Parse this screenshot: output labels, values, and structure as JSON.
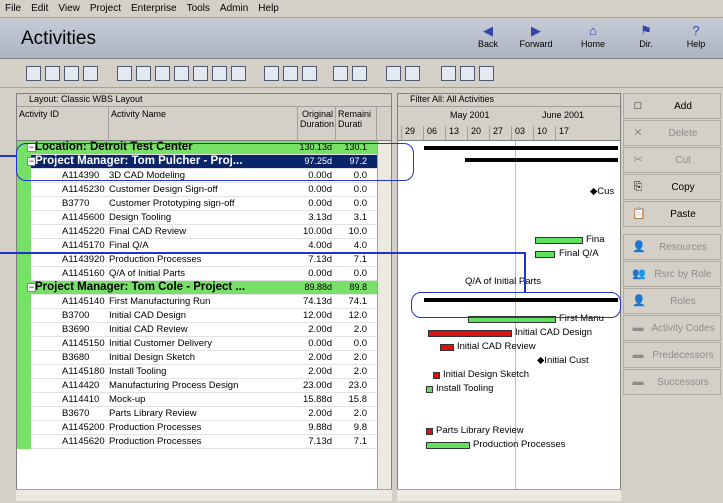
{
  "menu": [
    "File",
    "Edit",
    "View",
    "Project",
    "Enterprise",
    "Tools",
    "Admin",
    "Help"
  ],
  "header": {
    "title": "Activities",
    "nav": [
      {
        "label": "Back",
        "icon": "◀"
      },
      {
        "label": "Forward",
        "icon": "▶"
      },
      {
        "label": "Home",
        "icon": "⌂"
      },
      {
        "label": "Dir.",
        "icon": "⚑"
      },
      {
        "label": "Help",
        "icon": "?"
      }
    ]
  },
  "grid": {
    "layout_label": "Layout: Classic WBS Layout",
    "cols": {
      "id": "Activity ID",
      "name": "Activity Name",
      "orig": "Original Duration",
      "rem": "Remaini Durati"
    }
  },
  "rows": [
    {
      "type": "grp",
      "name": "Location: Detroit Test Center",
      "d1": "130.13d",
      "d2": "130.1"
    },
    {
      "type": "grp",
      "sel": true,
      "name": "Project Manager: Tom Pulcher - Proj...",
      "d1": "97.25d",
      "d2": "97.2"
    },
    {
      "id": "A114390",
      "name": "3D CAD Modeling",
      "d1": "0.00d",
      "d2": "0.0"
    },
    {
      "id": "A1145230",
      "name": "Customer Design Sign-off",
      "d1": "0.00d",
      "d2": "0.0"
    },
    {
      "id": "B3770",
      "name": "Customer Prototyping sign-off",
      "d1": "0.00d",
      "d2": "0.0"
    },
    {
      "id": "A1145600",
      "name": "Design Tooling",
      "d1": "3.13d",
      "d2": "3.1"
    },
    {
      "id": "A1145220",
      "name": "Final CAD Review",
      "d1": "10.00d",
      "d2": "10.0"
    },
    {
      "id": "A1145170",
      "name": "Final Q/A",
      "d1": "4.00d",
      "d2": "4.0"
    },
    {
      "id": "A1143920",
      "name": "Production Processes",
      "d1": "7.13d",
      "d2": "7.1"
    },
    {
      "id": "A1145160",
      "name": "Q/A of Initial Parts",
      "d1": "0.00d",
      "d2": "0.0"
    },
    {
      "type": "grp",
      "name": "Project Manager: Tom Cole - Project ...",
      "d1": "89.88d",
      "d2": "89.8"
    },
    {
      "id": "A1145140",
      "name": "First Manufacturing Run",
      "d1": "74.13d",
      "d2": "74.1"
    },
    {
      "id": "B3700",
      "name": "Initial CAD Design",
      "d1": "12.00d",
      "d2": "12.0"
    },
    {
      "id": "B3690",
      "name": "Initial CAD Review",
      "d1": "2.00d",
      "d2": "2.0"
    },
    {
      "id": "A1145150",
      "name": "Initial Customer Delivery",
      "d1": "0.00d",
      "d2": "0.0"
    },
    {
      "id": "B3680",
      "name": "Initial Design Sketch",
      "d1": "2.00d",
      "d2": "2.0"
    },
    {
      "id": "A1145180",
      "name": "Install Tooling",
      "d1": "2.00d",
      "d2": "2.0"
    },
    {
      "id": "A114420",
      "name": "Manufacturing Process Design",
      "d1": "23.00d",
      "d2": "23.0"
    },
    {
      "id": "A114410",
      "name": "Mock-up",
      "d1": "15.88d",
      "d2": "15.8"
    },
    {
      "id": "B3670",
      "name": "Parts Library Review",
      "d1": "2.00d",
      "d2": "2.0"
    },
    {
      "id": "A1145200",
      "name": "Production Processes",
      "d1": "9.88d",
      "d2": "9.8"
    },
    {
      "id": "A1145620",
      "name": "Production Processes",
      "d1": "7.13d",
      "d2": "7.1"
    }
  ],
  "gantt": {
    "filter_label": "Filter All: All Activities",
    "months": [
      "May 2001",
      "June 2001"
    ],
    "weeks": [
      "29",
      "06",
      "13",
      "20",
      "27",
      "03",
      "10",
      "17"
    ],
    "labels": {
      "cus": "◆Cus",
      "final_cad": "Fina",
      "final_qa": "Final Q/A",
      "qa_initial": "Q/A of Initial Parts",
      "first_manu": "First Manu",
      "initial_cad_design": "Initial CAD Design",
      "initial_cad_review": "Initial CAD Review",
      "initial_cust": "◆Initial Cust",
      "sketch": "Initial Design Sketch",
      "install": "Install Tooling",
      "parts": "Parts Library Review",
      "prod": "Production Processes"
    }
  },
  "side": [
    {
      "label": "Add",
      "icon": "□",
      "enabled": true
    },
    {
      "label": "Delete",
      "icon": "✕",
      "enabled": false
    },
    {
      "label": "Cut",
      "icon": "✂",
      "enabled": false
    },
    {
      "label": "Copy",
      "icon": "⎘",
      "enabled": true
    },
    {
      "label": "Paste",
      "icon": "📋",
      "enabled": true
    },
    {
      "label": "Resources",
      "icon": "👤",
      "enabled": false
    },
    {
      "label": "Rsrc by Role",
      "icon": "👥",
      "enabled": false
    },
    {
      "label": "Roles",
      "icon": "👤",
      "enabled": false
    },
    {
      "label": "Activity Codes",
      "icon": "▬",
      "enabled": false
    },
    {
      "label": "Predecessors",
      "icon": "▬",
      "enabled": false
    },
    {
      "label": "Successors",
      "icon": "▬",
      "enabled": false
    }
  ]
}
